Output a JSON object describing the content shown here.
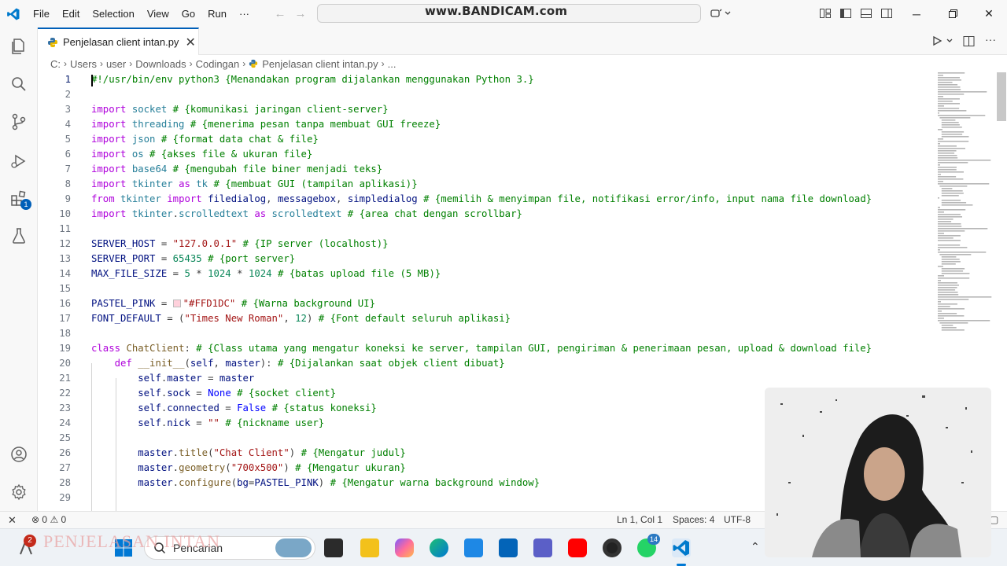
{
  "menu": [
    "File",
    "Edit",
    "Selection",
    "View",
    "Go",
    "Run",
    "···"
  ],
  "watermark": "www.BANDICAM.com",
  "tab": {
    "label": "Penjelasan client intan.py",
    "close": "✕"
  },
  "breadcrumb": [
    "C:",
    "Users",
    "user",
    "Downloads",
    "Codingan",
    "Penjelasan client intan.py",
    "..."
  ],
  "activity": {
    "extensions_badge": "1"
  },
  "code_lines": [
    {
      "n": "1",
      "t": "#!/usr/bin/env python3 {Menandakan program dijalankan menggunakan Python 3.}"
    },
    {
      "n": "2",
      "t": ""
    },
    {
      "n": "3",
      "t": "import socket # {komunikasi jaringan client-server}"
    },
    {
      "n": "4",
      "t": "import threading # {menerima pesan tanpa membuat GUI freeze}"
    },
    {
      "n": "5",
      "t": "import json # {format data chat & file}"
    },
    {
      "n": "6",
      "t": "import os # {akses file & ukuran file}"
    },
    {
      "n": "7",
      "t": "import base64 # {mengubah file biner menjadi teks}"
    },
    {
      "n": "8",
      "t": "import tkinter as tk # {membuat GUI (tampilan aplikasi)}"
    },
    {
      "n": "9",
      "t": "from tkinter import filedialog, messagebox, simpledialog # {memilih & menyimpan file, notifikasi error/info, input nama file download}"
    },
    {
      "n": "10",
      "t": "import tkinter.scrolledtext as scrolledtext # {area chat dengan scrollbar}"
    },
    {
      "n": "11",
      "t": ""
    },
    {
      "n": "12",
      "t": "SERVER_HOST = \"127.0.0.1\" # {IP server (localhost)}"
    },
    {
      "n": "13",
      "t": "SERVER_PORT = 65435 # {port server}"
    },
    {
      "n": "14",
      "t": "MAX_FILE_SIZE = 5 * 1024 * 1024 # {batas upload file (5 MB)}"
    },
    {
      "n": "15",
      "t": ""
    },
    {
      "n": "16",
      "t": "PASTEL_PINK = \"#FFD1DC\" # {Warna background UI}"
    },
    {
      "n": "17",
      "t": "FONT_DEFAULT = (\"Times New Roman\", 12) # {Font default seluruh aplikasi}"
    },
    {
      "n": "18",
      "t": ""
    },
    {
      "n": "19",
      "t": "class ChatClient: # {Class utama yang mengatur koneksi ke server, tampilan GUI, pengiriman & penerimaan pesan, upload & download file}"
    },
    {
      "n": "20",
      "t": "    def __init__(self, master): # {Dijalankan saat objek client dibuat}"
    },
    {
      "n": "21",
      "t": "        self.master = master"
    },
    {
      "n": "22",
      "t": "        self.sock = None # {socket client}"
    },
    {
      "n": "23",
      "t": "        self.connected = False # {status koneksi}"
    },
    {
      "n": "24",
      "t": "        self.nick = \"\" # {nickname user}"
    },
    {
      "n": "25",
      "t": ""
    },
    {
      "n": "26",
      "t": "        master.title(\"Chat Client\") # {Mengatur judul}"
    },
    {
      "n": "27",
      "t": "        master.geometry(\"700x500\") # {Mengatur ukuran}"
    },
    {
      "n": "28",
      "t": "        master.configure(bg=PASTEL_PINK) # {Mengatur warna background window}"
    },
    {
      "n": "29",
      "t": ""
    }
  ],
  "status": {
    "errors": "0",
    "warnings": "0",
    "position": "Ln 1, Col 1",
    "spaces": "Spaces: 4",
    "encoding": "UTF-8"
  },
  "taskbar": {
    "search_label": "Pencarian",
    "notif_badge": "2",
    "whatsapp_badge": "14",
    "overlay_text": "PENJELASAN INTAN"
  },
  "colors": {
    "accent": "#005fb8",
    "keyword": "#af00db",
    "string": "#a31515",
    "comment": "#008000",
    "number": "#098658",
    "pastel_pink": "#FFD1DC"
  }
}
